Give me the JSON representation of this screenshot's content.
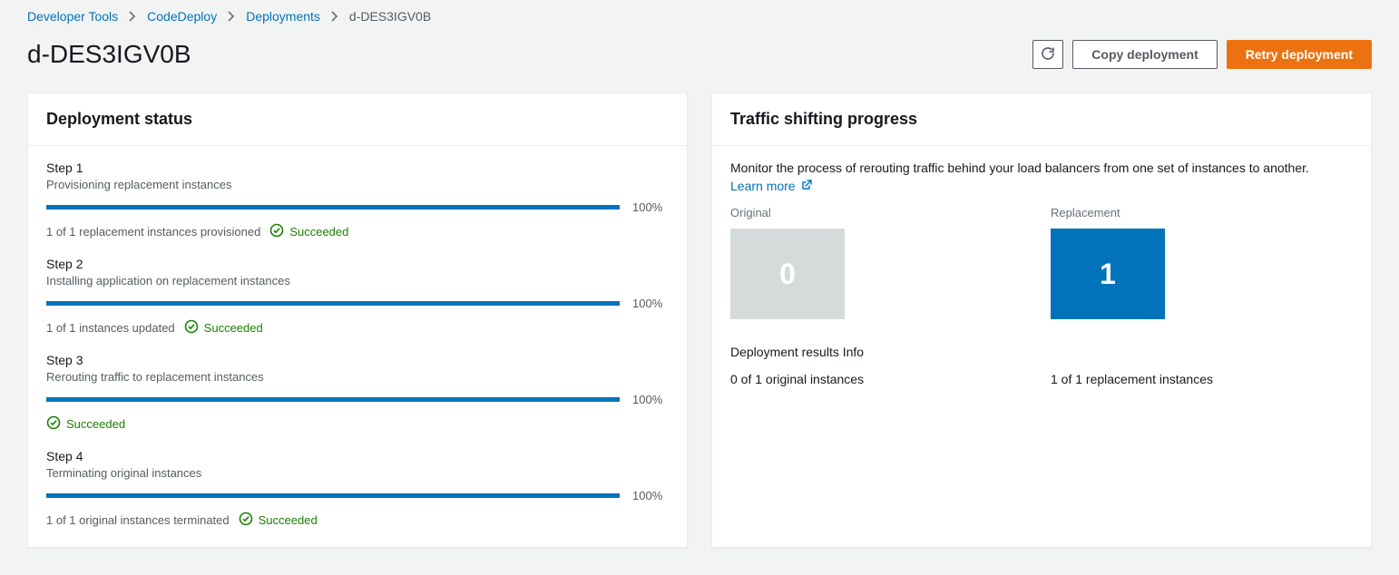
{
  "breadcrumb": {
    "items": [
      {
        "label": "Developer Tools"
      },
      {
        "label": "CodeDeploy"
      },
      {
        "label": "Deployments"
      }
    ],
    "current": "d-DES3IGV0B"
  },
  "page_title": "d-DES3IGV0B",
  "actions": {
    "copy_label": "Copy deployment",
    "retry_label": "Retry deployment"
  },
  "deployment_status": {
    "panel_title": "Deployment status",
    "steps": [
      {
        "title": "Step 1",
        "desc": "Provisioning replacement instances",
        "pct": "100%",
        "status_prefix": "1 of 1 replacement instances provisioned",
        "status_label": "Succeeded"
      },
      {
        "title": "Step 2",
        "desc": "Installing application on replacement instances",
        "pct": "100%",
        "status_prefix": "1 of 1 instances updated",
        "status_label": "Succeeded"
      },
      {
        "title": "Step 3",
        "desc": "Rerouting traffic to replacement instances",
        "pct": "100%",
        "status_prefix": "",
        "status_label": "Succeeded"
      },
      {
        "title": "Step 4",
        "desc": "Terminating original instances",
        "pct": "100%",
        "status_prefix": "1 of 1 original instances terminated",
        "status_label": "Succeeded"
      }
    ]
  },
  "traffic_shifting": {
    "panel_title": "Traffic shifting progress",
    "description": "Monitor the process of rerouting traffic behind your load balancers from one set of instances to another.",
    "learn_more": "Learn more",
    "original_label": "Original",
    "replacement_label": "Replacement",
    "original_count": "0",
    "replacement_count": "1",
    "results_label": "Deployment results Info",
    "original_result": "0 of 1 original instances",
    "replacement_result": "1 of 1 replacement instances"
  }
}
